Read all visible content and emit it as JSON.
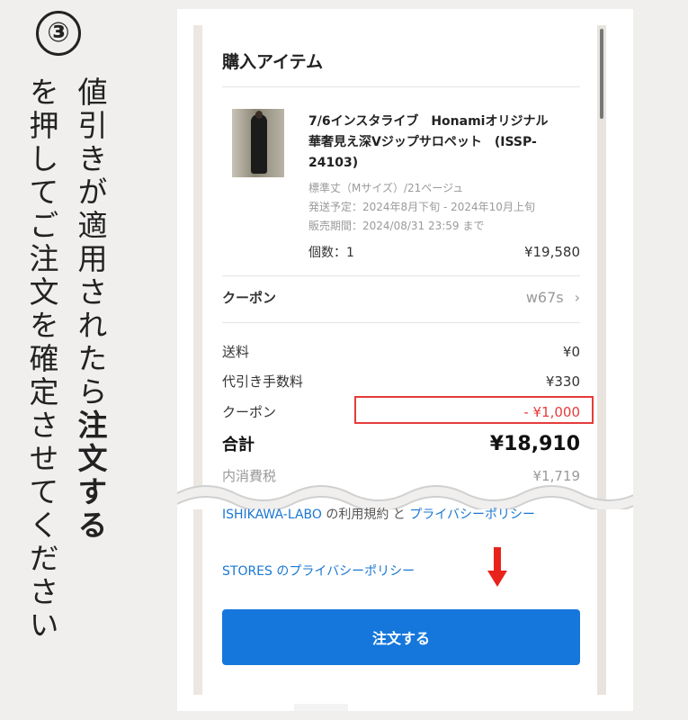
{
  "instruction": {
    "step_number": "③",
    "column1_text": "値引きが適用されたら",
    "column1_bold": "注文する",
    "column2_text": "を押してご注文を確定させてください"
  },
  "section": {
    "title": "購入アイテム"
  },
  "item": {
    "name": "7/6インスタライブ　Honamiオリジナル　華奢見え深Vジップサロペット　(ISSP-24103)",
    "variant": "標準丈（Mサイズ）/21ページュ",
    "shipping": "発送予定：2024年8月下旬 - 2024年10月上旬",
    "sale_period": "販売期間：2024/08/31 23:59 まで",
    "quantity_label": "個数：1",
    "price": "¥19,580"
  },
  "coupon": {
    "label": "クーポン",
    "code": "w67s"
  },
  "summary": {
    "shipping_label": "送料",
    "shipping_value": "¥0",
    "cod_label": "代引き手数料",
    "cod_value": "¥330",
    "coupon_label": "クーポン",
    "coupon_value": "- ¥1,000",
    "total_label": "合計",
    "total_value": "¥18,910",
    "tax_label": "内消費税",
    "tax_value": "¥1,719"
  },
  "links": {
    "terms_a": "ISHIKAWA-LABO",
    "terms_b": " の利用規約 と ",
    "terms_c": "プライバシーポリシー",
    "privacy": "STORES のプライバシーポリシー"
  },
  "order_button_label": "注文する",
  "colors": {
    "accent_blue": "#1577db",
    "highlight_red": "#e53b3b",
    "arrow_red": "#e8231c"
  }
}
